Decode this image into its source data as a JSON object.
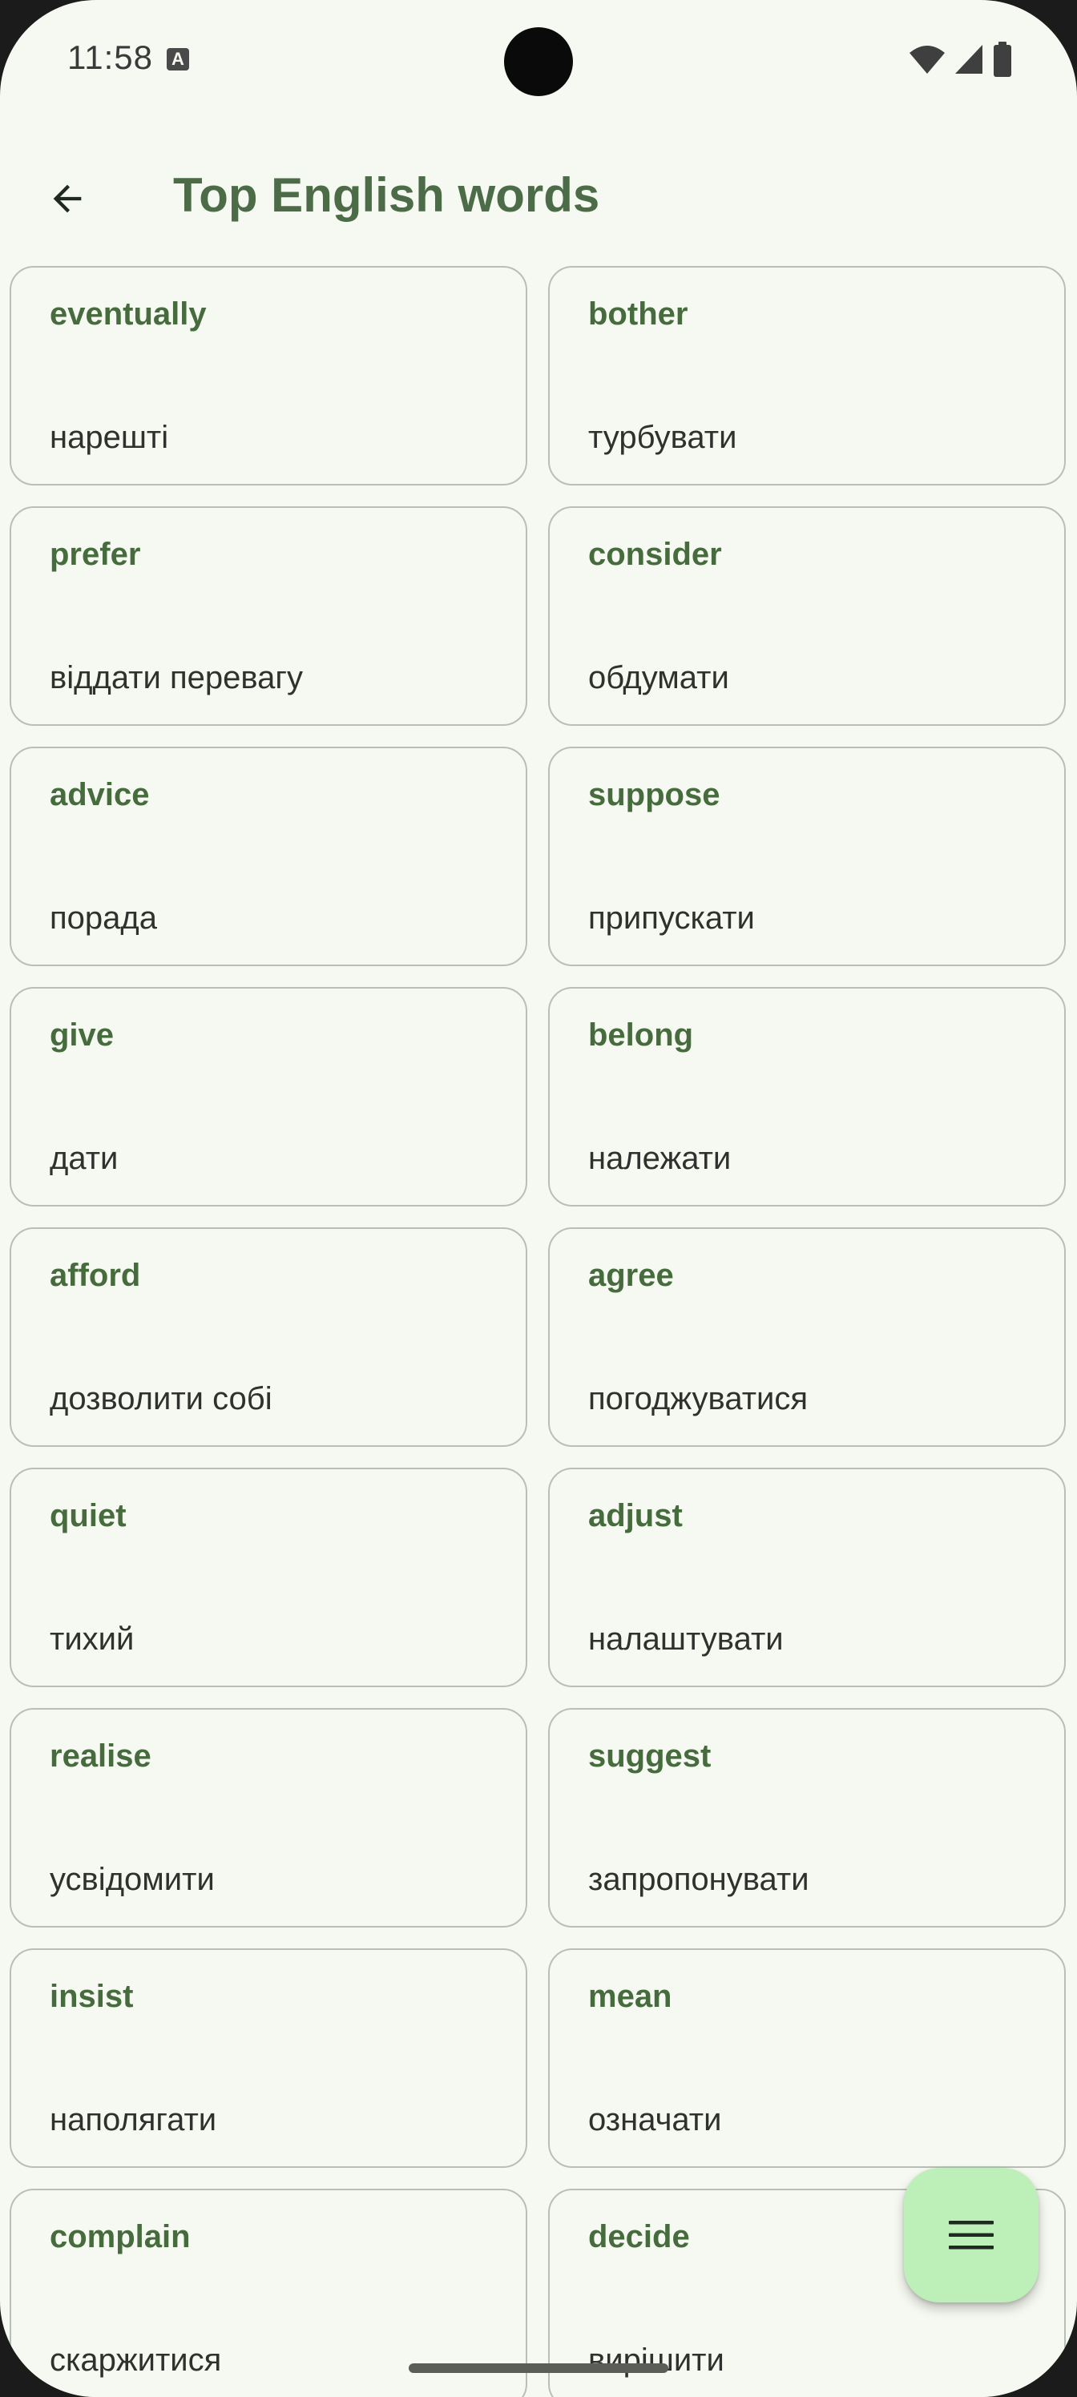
{
  "status_bar": {
    "time": "11:58",
    "notification_icon_letter": "A",
    "icons": [
      "wifi-icon",
      "signal-icon",
      "battery-icon"
    ]
  },
  "app_bar": {
    "back_icon": "arrow-back-icon",
    "title": "Top English words"
  },
  "words": [
    {
      "en": "eventually",
      "ua": "нарешті"
    },
    {
      "en": "bother",
      "ua": "турбувати"
    },
    {
      "en": "prefer",
      "ua": "віддати перевагу"
    },
    {
      "en": "consider",
      "ua": "обдумати"
    },
    {
      "en": "advice",
      "ua": "порада"
    },
    {
      "en": "suppose",
      "ua": "припускати"
    },
    {
      "en": "give",
      "ua": "дати"
    },
    {
      "en": "belong",
      "ua": "належати"
    },
    {
      "en": "afford",
      "ua": "дозволити собі"
    },
    {
      "en": "agree",
      "ua": "погоджуватися"
    },
    {
      "en": "quiet",
      "ua": "тихий"
    },
    {
      "en": "adjust",
      "ua": "налаштувати"
    },
    {
      "en": "realise",
      "ua": "усвідомити"
    },
    {
      "en": "suggest",
      "ua": "запропонувати"
    },
    {
      "en": "insist",
      "ua": "наполягати"
    },
    {
      "en": "mean",
      "ua": "означати"
    },
    {
      "en": "complain",
      "ua": "скаржитися"
    },
    {
      "en": "decide",
      "ua": "вирішити"
    }
  ],
  "fab": {
    "icon": "menu-icon"
  },
  "colors": {
    "background": "#f6f9f1",
    "accent_text": "#466b3d",
    "title_text": "#4c6b47",
    "card_border": "#b9bfb6",
    "fab_background": "#bdf0b9"
  }
}
